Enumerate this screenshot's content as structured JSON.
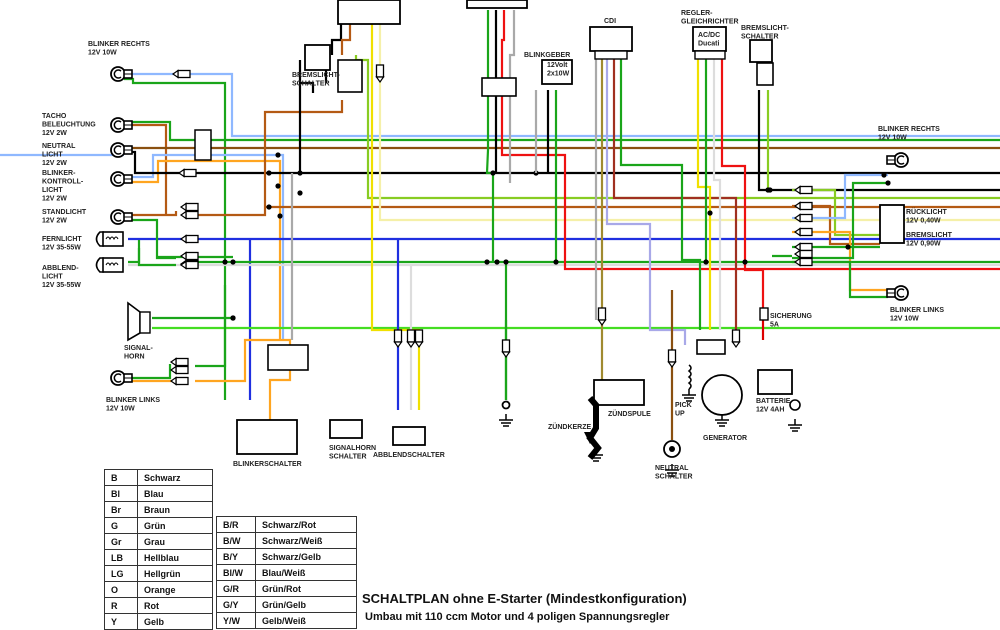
{
  "title": "SCHALTPLAN ohne E-Starter (Mindestkonfiguration)",
  "subtitle": "Umbau mit 110 ccm Motor und 4 poligen Spannungsregler",
  "wire_colors": {
    "B": "#000000",
    "Bl": "#1f2fe0",
    "Br": "#b45a14",
    "G": "#1aa51a",
    "Gr": "#a9a9a9",
    "LB": "#8fb8ff",
    "LG": "#44dd22",
    "O": "#ffa520",
    "R": "#ee1111",
    "Y": "#f0e000",
    "W": "#dddddd",
    "GY": "#88cc22",
    "YW": "#f5f0a8",
    "BW": "#a8a8e8",
    "BY": "#a08a30",
    "BR": "#a03020",
    "GR": "#8a5010",
    "fuse": "#dd0000"
  },
  "legend_single": [
    {
      "code": "B",
      "name": "Schwarz"
    },
    {
      "code": "Bl",
      "name": "Blau"
    },
    {
      "code": "Br",
      "name": "Braun"
    },
    {
      "code": "G",
      "name": "Grün"
    },
    {
      "code": "Gr",
      "name": "Grau"
    },
    {
      "code": "LB",
      "name": "Hellblau"
    },
    {
      "code": "LG",
      "name": "Hellgrün"
    },
    {
      "code": "O",
      "name": "Orange"
    },
    {
      "code": "R",
      "name": "Rot"
    },
    {
      "code": "Y",
      "name": "Gelb"
    }
  ],
  "legend_dual": [
    {
      "code": "B/R",
      "name": "Schwarz/Rot"
    },
    {
      "code": "B/W",
      "name": "Schwarz/Weiß"
    },
    {
      "code": "B/Y",
      "name": "Schwarz/Gelb"
    },
    {
      "code": "Bl/W",
      "name": "Blau/Weiß"
    },
    {
      "code": "G/R",
      "name": "Grün/Rot"
    },
    {
      "code": "G/Y",
      "name": "Grün/Gelb"
    },
    {
      "code": "Y/W",
      "name": "Gelb/Weiß"
    }
  ],
  "components": {
    "blinker_rechts_front": [
      "BLINKER RECHTS",
      "12V 10W"
    ],
    "tacho": [
      "TACHO",
      "BELEUCHTUNG",
      "12V 2W"
    ],
    "neutral_licht": [
      "NEUTRAL",
      "LICHT",
      "12V 2W"
    ],
    "blinker_kontroll": [
      "BLINKER-",
      "KONTROLL-",
      "LICHT",
      "12V 2W"
    ],
    "standlicht": [
      "STANDLICHT",
      "12V 2W"
    ],
    "fernlicht": [
      "FERNLICHT",
      "12V 35-55W"
    ],
    "abblendlicht": [
      "ABBLEND-",
      "LICHT",
      "12V 35-55W"
    ],
    "signalhorn": [
      "SIGNAL-",
      "HORN"
    ],
    "blinker_links_front": [
      "BLINKER LINKS",
      "12V 10W"
    ],
    "bremslicht_schalter_vorn": [
      "BREMSLICHT-",
      "SCHALTER"
    ],
    "blinkerschalter": "BLINKERSCHALTER",
    "signalhorn_schalter": [
      "SIGNALHORN",
      "SCHALTER"
    ],
    "abblendschalter": "ABBLENDSCHALTER",
    "blinkgeber": "BLINKGEBER",
    "blinkgeber_spec": [
      "12Volt",
      "2x10W"
    ],
    "cdi": "CDI",
    "regler": [
      "REGLER-",
      "GLEICHRICHTER"
    ],
    "regler_spec": [
      "AC/DC",
      "Ducati"
    ],
    "bremslicht_schalter_hinten": [
      "BREMSLICHT-",
      "SCHALTER"
    ],
    "blinker_rechts_rear": [
      "BLINKER RECHTS",
      "12V 10W"
    ],
    "ruecklicht": [
      "RÜCKLICHT",
      "12V 0,40W"
    ],
    "bremslicht": [
      "BREMSLICHT",
      "12V 0,90W"
    ],
    "blinker_links_rear": [
      "BLINKER LINKS",
      "12V 10W"
    ],
    "sicherung": [
      "SICHERUNG",
      "5A"
    ],
    "batterie": [
      "BATTERIE",
      "12V 4AH"
    ],
    "generator": "GENERATOR",
    "pickup": [
      "PICK",
      "UP"
    ],
    "neutral_schalter": [
      "NEUTRAL",
      "SCHALTER"
    ],
    "zuendspule": "ZÜNDSPULE",
    "zuendkerze": "ZÜNDKERZE"
  }
}
